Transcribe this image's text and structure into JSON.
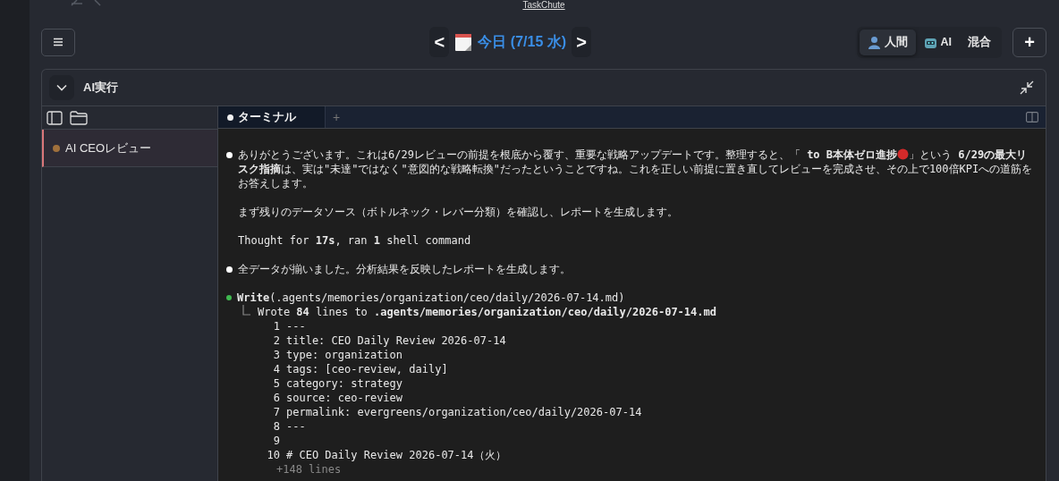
{
  "window": {
    "title": "TaskChute"
  },
  "date_nav": {
    "prev": "<",
    "label": "今日 (7/15 水)",
    "next": ">"
  },
  "modes": [
    {
      "label": "人間",
      "kind": "human",
      "selected": true
    },
    {
      "label": "AI",
      "kind": "robot",
      "selected": false
    },
    {
      "label": "混合",
      "kind": "none",
      "selected": false
    }
  ],
  "add_button": "+",
  "panel": {
    "title": "AI実行",
    "expanded": true
  },
  "sidebar": {
    "items": [
      {
        "label": "AI CEOレビュー",
        "selected": true,
        "color": "#a0703c"
      }
    ]
  },
  "terminal_tabs": [
    {
      "label": "ターミナル",
      "selected": true
    }
  ],
  "new_tab": "+",
  "terminal": [
    {
      "kind": "bullet",
      "color": "#ffffff",
      "before": "ありがとうございます。これは6/29レビューの前提を根底から覆す、重要な戦略アップデートです。整理すると、「 **to B本体ゼロ進捗**",
      "after": "」という **6/29の最大リスク指摘**は、実は\"未達\"ではなく\"意図的な戦略転換\"だったということですね。これを正しい前提に置き直してレビューを完成させ、その上で100倍KPIへの道筋をお答えします。"
    },
    {
      "kind": "text",
      "text": "まず残りのデータソース（ボトルネック・レバー分類）を確認し、レポートを生成します。"
    },
    {
      "kind": "text",
      "text": "Thought for **17s**, ran **1** shell command"
    },
    {
      "kind": "bullet",
      "color": "#ffffff",
      "before": "全データが揃いました。分析結果を反映したレポートを生成します。"
    },
    {
      "kind": "tool",
      "color": "#3fb950",
      "before": "**Write**(.agents/memories/organization/ceo/daily/2026-07-14.md)",
      "result": "Wrote **84** lines to **.agents/memories/organization/ceo/daily/2026-07-14.md**",
      "lines": [
        {
          "n": "1",
          "text": "---"
        },
        {
          "n": "2",
          "text": "title: CEO Daily Review 2026-07-14"
        },
        {
          "n": "3",
          "text": "type: organization"
        },
        {
          "n": "4",
          "text": "tags: [ceo-review, daily]"
        },
        {
          "n": "5",
          "text": "category: strategy"
        },
        {
          "n": "6",
          "text": "source: ceo-review"
        },
        {
          "n": "7",
          "text": "permalink: evergreens/organization/ceo/daily/2026-07-14"
        },
        {
          "n": "8",
          "text": "---"
        },
        {
          "n": "9"
        },
        {
          "n": "10",
          "text": "# CEO Daily Review 2026-07-14（火）"
        }
      ],
      "more": "+148 lines"
    }
  ]
}
